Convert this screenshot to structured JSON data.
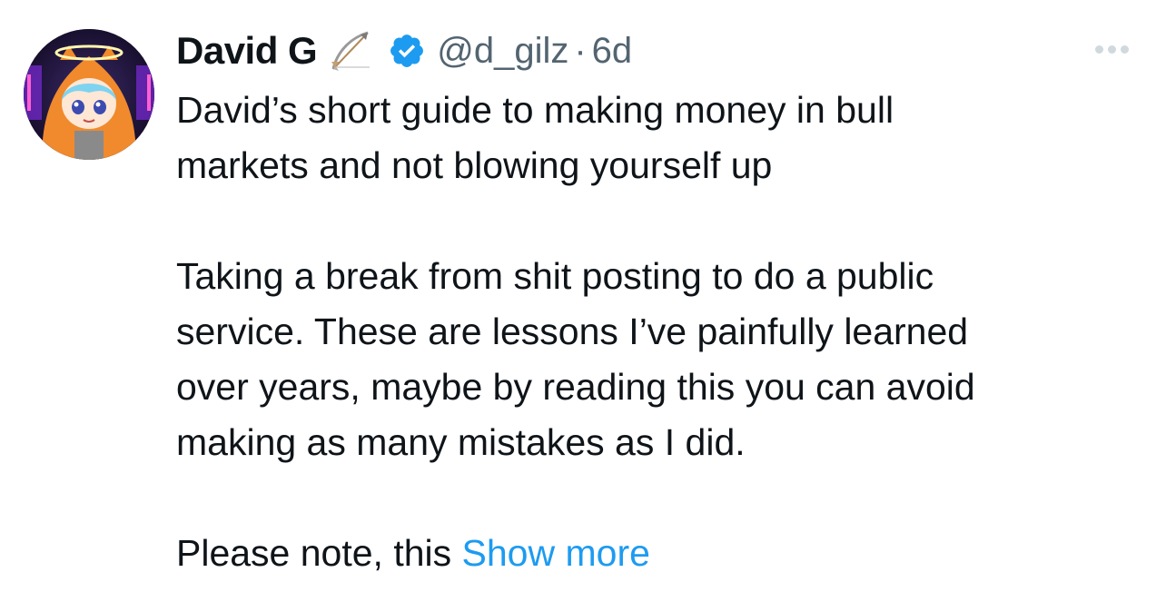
{
  "tweet": {
    "author": {
      "display_name": "David G",
      "name_emoji": "bow-and-arrow-emoji",
      "verified_icon": "verified-badge-icon",
      "handle": "@d_gilz",
      "separator": "·",
      "time": "6d",
      "avatar": "avatar-anime-orange-hoodie"
    },
    "more_icon": "more-options-icon",
    "paragraphs": [
      [
        "David’s short guide to making money in bull",
        "markets and not blowing yourself up"
      ],
      [
        "Taking a break from shit posting to do a public",
        "service. These are lessons I’ve painfully learned",
        "over years, maybe by reading this you can avoid",
        "making as many mistakes as I did."
      ]
    ],
    "last_line": "Please note, this ",
    "show_more_label": "Show more",
    "colors": {
      "text": "#0f1419",
      "secondary": "#536471",
      "link": "#1d9bf0",
      "verified": "#1d9bf0"
    }
  }
}
